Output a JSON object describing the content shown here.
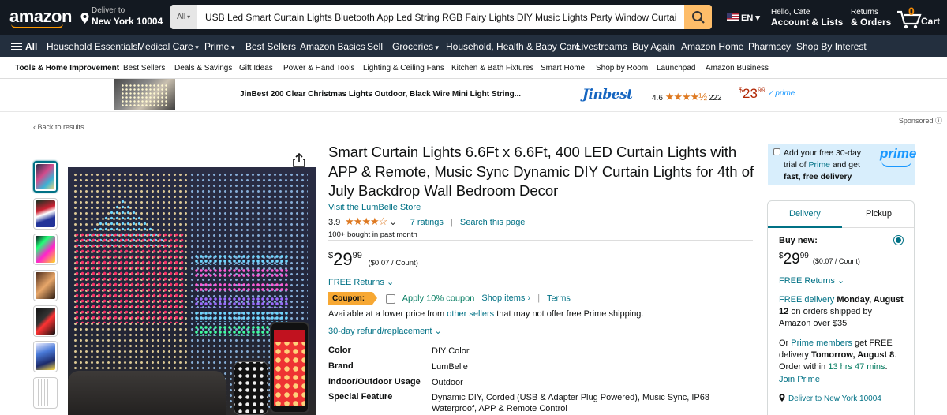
{
  "nav": {
    "logo": "amazon",
    "deliver_label": "Deliver to",
    "deliver_location": "New York 10004",
    "search_category": "All",
    "search_value": "USB Led Smart Curtain Lights Bluetooth App Led String RGB Fairy Lights DIY Music Lights Party Window Curtain Bedroom",
    "language": "EN",
    "account_line1": "Hello, Cate",
    "account_line2": "Account & Lists",
    "returns_line1": "Returns",
    "returns_line2": "& Orders",
    "cart_count": "0",
    "cart_label": "Cart"
  },
  "main_nav": [
    "Household Essentials",
    "Medical Care",
    "Prime",
    "Best Sellers",
    "Amazon Basics",
    "Sell",
    "Groceries",
    "Household, Health & Baby Care",
    "Livestreams",
    "Buy Again",
    "Amazon Home",
    "Pharmacy",
    "Shop By Interest"
  ],
  "main_nav_all": "All",
  "sub_nav": [
    "Tools & Home Improvement",
    "Best Sellers",
    "Deals & Savings",
    "Gift Ideas",
    "Power & Hand Tools",
    "Lighting & Ceiling Fans",
    "Kitchen & Bath Fixtures",
    "Smart Home",
    "Shop by Room",
    "Launchpad",
    "Amazon Business"
  ],
  "banner": {
    "title": "JinBest 200 Clear Christmas Lights Outdoor, Black Wire Mini Light String...",
    "brand": "Jinbest",
    "rating": "4.6",
    "review_count": "222",
    "price_symbol": "$",
    "price_whole": "23",
    "price_fraction": "99",
    "prime": "prime",
    "sponsored": "Sponsored"
  },
  "back_link": "‹ Back to results",
  "product": {
    "title": "Smart Curtain Lights 6.6Ft x 6.6Ft, 400 LED Curtain Lights with APP & Remote, Music Sync Dynamic DIY Curtain Lights for 4th of July Backdrop Wall Bedroom Decor",
    "store": "Visit the LumBelle Store",
    "rating": "3.9",
    "stars": "★★★★☆",
    "ratings_count": "7 ratings",
    "search_page": "Search this page",
    "bought": "100+ bought in past month",
    "price_symbol": "$",
    "price_whole": "29",
    "price_fraction": "99",
    "unit_price": "($0.07 / Count)",
    "free_returns": "FREE Returns",
    "coupon_label": "Coupon:",
    "coupon_apply": "Apply 10% coupon",
    "coupon_shop": "Shop items ›",
    "coupon_terms": "Terms",
    "lower_price_prefix": "Available at a lower price from",
    "lower_price_link": "other sellers",
    "lower_price_suffix": "that may not offer free Prime shipping.",
    "refund": "30-day refund/replacement",
    "specs": [
      {
        "key": "Color",
        "value": "DIY Color"
      },
      {
        "key": "Brand",
        "value": "LumBelle"
      },
      {
        "key": "Indoor/Outdoor Usage",
        "value": "Outdoor"
      },
      {
        "key": "Special Feature",
        "value": "Dynamic DIY, Corded (USB & Adapter Plug Powered), Music Sync, IP68 Waterproof, APP & Remote Control"
      }
    ]
  },
  "prime_offer": {
    "text_before": "Add your free 30-day trial of",
    "link": "Prime",
    "text_after": "and get",
    "bold": "fast, free delivery",
    "logo": "prime"
  },
  "buybox": {
    "tab_delivery": "Delivery",
    "tab_pickup": "Pickup",
    "buy_new": "Buy new:",
    "price_symbol": "$",
    "price_whole": "29",
    "price_fraction": "99",
    "unit_price": "($0.07 / Count)",
    "free_returns": "FREE Returns",
    "free_delivery_link": "FREE delivery",
    "free_delivery_date": "Monday, August 12",
    "free_delivery_note": "on orders shipped by Amazon over $35",
    "or": "Or",
    "prime_members": "Prime members",
    "prime_get": "get FREE delivery",
    "prime_date": "Tomorrow, August 8",
    "order_within": "Order within",
    "countdown": "13 hrs 47 mins",
    "join_prime": "Join Prime",
    "deliver_to": "Deliver to New York 10004"
  }
}
